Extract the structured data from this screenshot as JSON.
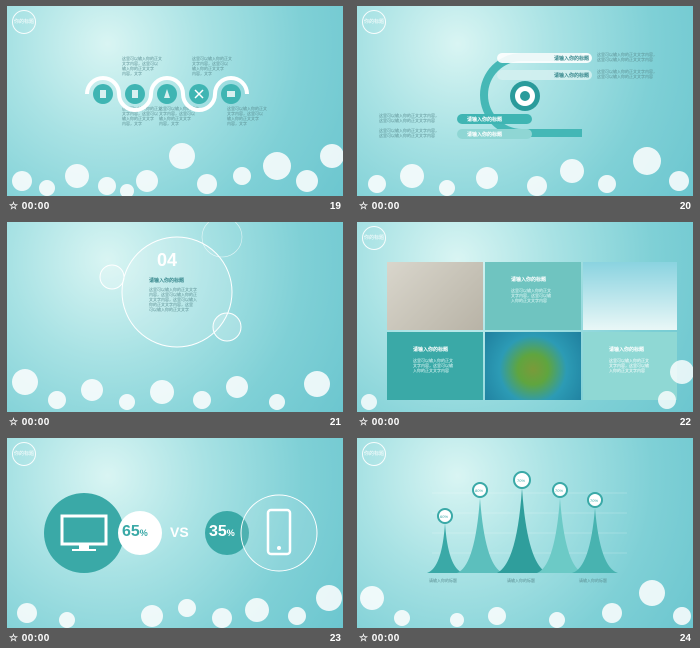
{
  "slides": [
    {
      "number": "19",
      "time": "00:00",
      "logo": "你的标题"
    },
    {
      "number": "20",
      "time": "00:00",
      "logo": "你的标题"
    },
    {
      "number": "21",
      "time": "00:00",
      "logo": ""
    },
    {
      "number": "22",
      "time": "00:00",
      "logo": "你的标题"
    },
    {
      "number": "23",
      "time": "00:00",
      "logo": "你的标题"
    },
    {
      "number": "24",
      "time": "00:00",
      "logo": "你的标题"
    }
  ],
  "s19": {
    "para": "这里可以输入你的正文\n文字内容，这里可以\n输入你的正文文字\n内容，文字"
  },
  "s20": {
    "title": "请输入你的标题",
    "para": "这里可以输入你的正文文字内容，\n这里可以输入你的正文文字内容"
  },
  "s21": {
    "num": "04",
    "title": "请输入你的标题",
    "para": "这里可以输入你的正文文字\n内容，这里可以输入你的正\n文文字内容，这里可以输入\n你的正文文字内容，这里\n可以输入你的正文文字"
  },
  "s22": {
    "title": "请输入你的标题",
    "para": "这里可以输入你的正文\n文字内容，这里可以输\n入你的正文文字内容"
  },
  "s23": {
    "pct1": "65",
    "pct2": "35",
    "sym": "%",
    "vs": "VS"
  },
  "s24": {
    "pcts": [
      "60%",
      "80%",
      "70%",
      "70%",
      "70%"
    ],
    "label": "请输入你的标题"
  },
  "colors": {
    "accent": "#3fb5b3",
    "bg": "#5a5a5a"
  }
}
